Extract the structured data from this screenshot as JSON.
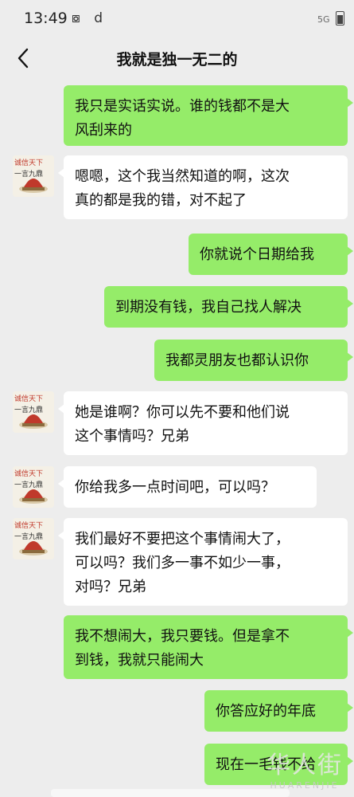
{
  "status_bar": {
    "time": "13:49",
    "icons": "⧇ d",
    "signal": "5G"
  },
  "header": {
    "title": "我就是独一无二的"
  },
  "avatar": {
    "line1": "诚信天下",
    "line2": "一言九鼎"
  },
  "messages": [
    {
      "side": "out",
      "lines": [
        "我只是实话实说。谁的钱都不是大",
        "风刮来的"
      ]
    },
    {
      "side": "in",
      "lines": [
        "嗯嗯，这个我当然知道的啊，这次",
        "真的都是我的错，对不起了"
      ]
    },
    {
      "side": "out",
      "lines": [
        "你就说个日期给我"
      ]
    },
    {
      "side": "out",
      "lines": [
        "到期没有钱，我自己找人解决"
      ]
    },
    {
      "side": "out",
      "lines": [
        "我都灵朋友也都认识你"
      ]
    },
    {
      "side": "in",
      "lines": [
        "她是谁啊？你可以先不要和他们说",
        "这个事情吗？兄弟"
      ]
    },
    {
      "side": "in",
      "lines": [
        "你给我多一点时间吧，可以吗？"
      ]
    },
    {
      "side": "in",
      "lines": [
        "我们最好不要把这个事情闹大了，",
        "可以吗？我们多一事不如少一事，",
        "对吗？兄弟"
      ]
    },
    {
      "side": "out",
      "lines": [
        "我不想闹大，我只要钱。但是拿不",
        "到钱，我就只能闹大"
      ]
    },
    {
      "side": "out",
      "lines": [
        "你答应好的年底"
      ]
    },
    {
      "side": "out",
      "lines": [
        "现在一毛钱不给"
      ]
    }
  ],
  "watermark": {
    "main": "华人街",
    "sub": "HUARENJIE"
  },
  "colors": {
    "background": "#ededed",
    "outgoing_bubble": "#95ec69",
    "incoming_bubble": "#ffffff",
    "avatar_accent": "#c0392b"
  }
}
